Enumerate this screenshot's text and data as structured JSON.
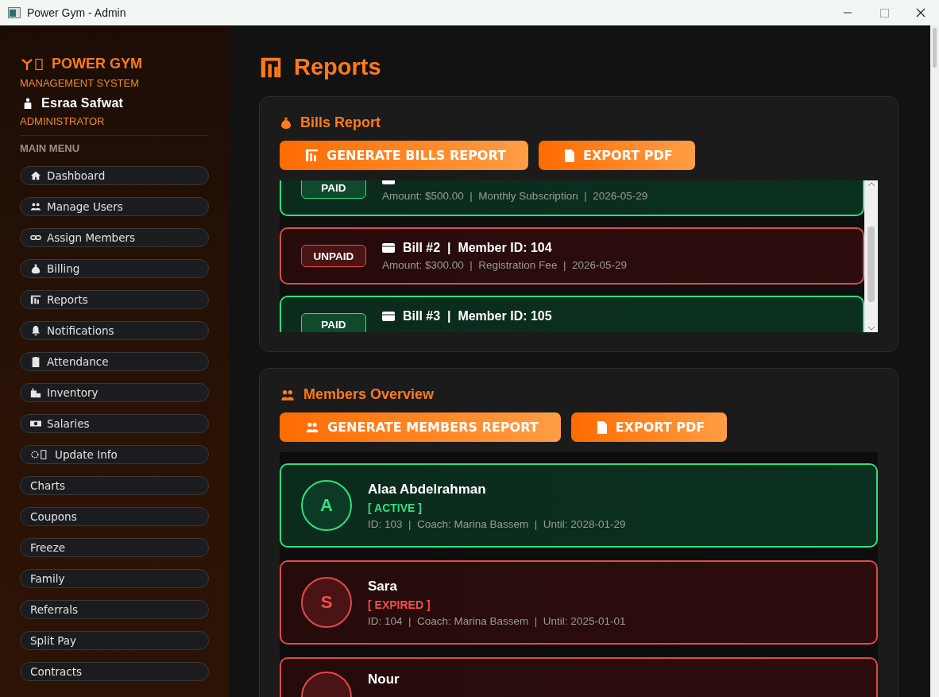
{
  "window": {
    "title": "Power Gym - Admin"
  },
  "sidebar": {
    "brand": {
      "title": "POWER GYM",
      "subtitle": "MANAGEMENT SYSTEM"
    },
    "user": {
      "name": "Esraa Safwat",
      "role": "ADMINISTRATOR"
    },
    "menu_heading": "MAIN MENU",
    "items": [
      {
        "label": "Dashboard"
      },
      {
        "label": "Manage Users"
      },
      {
        "label": "Assign Members"
      },
      {
        "label": "Billing"
      },
      {
        "label": "Reports"
      },
      {
        "label": "Notifications"
      },
      {
        "label": "Attendance"
      },
      {
        "label": "Inventory"
      },
      {
        "label": "Salaries"
      },
      {
        "label": "Update Info"
      },
      {
        "label": "Charts"
      },
      {
        "label": "Coupons"
      },
      {
        "label": "Freeze"
      },
      {
        "label": "Family"
      },
      {
        "label": "Referrals"
      },
      {
        "label": "Split Pay"
      },
      {
        "label": "Contracts"
      }
    ]
  },
  "page": {
    "title": "Reports"
  },
  "bills_report": {
    "title": "Bills Report",
    "buttons": [
      "GENERATE BILLS REPORT",
      "EXPORT PDF"
    ],
    "bills": [
      {
        "kind": "paid",
        "badge": "PAID",
        "details": "Amount: $500.00  |  Monthly Subscription  |  2026-05-29"
      },
      {
        "kind": "unpaid",
        "badge": "UNPAID",
        "title": "Bill #2  |  Member ID: 104",
        "details": "Amount: $300.00  |  Registration Fee  |  2026-05-29"
      },
      {
        "kind": "paid",
        "badge": "PAID",
        "title": "Bill #3  |  Member ID: 105"
      }
    ]
  },
  "members_overview": {
    "title": "Members Overview",
    "buttons": [
      "GENERATE MEMBERS REPORT",
      "EXPORT PDF"
    ],
    "members": [
      {
        "kind": "active",
        "initial": "A",
        "name": "Alaa Abdelrahman",
        "status": "[ ACTIVE ]",
        "details": "ID: 103  |  Coach: Marina Bassem  |  Until: 2028-01-29"
      },
      {
        "kind": "expired",
        "initial": "S",
        "name": "Sara",
        "status": "[ EXPIRED ]",
        "details": "ID: 104  |  Coach: Marina Bassem  |  Until: 2025-01-01"
      },
      {
        "kind": "expired",
        "name": "Nour"
      }
    ]
  }
}
